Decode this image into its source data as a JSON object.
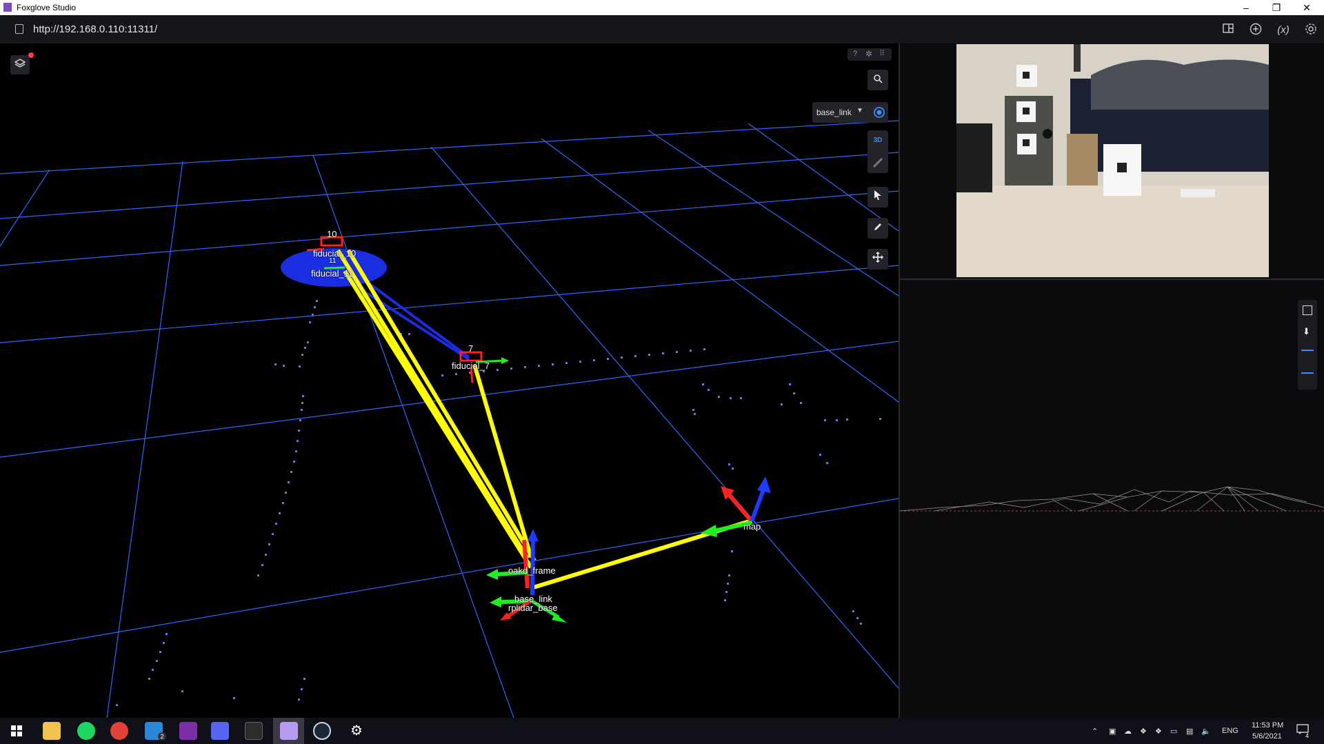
{
  "window": {
    "title": "Foxglove Studio",
    "minimize": "–",
    "restore": "❐",
    "close": "✕"
  },
  "url_bar": {
    "url": "http://192.168.0.110:11311/"
  },
  "top_icons": [
    "layout-icon",
    "add-panel-icon",
    "variables-icon",
    "settings-icon"
  ],
  "top_labels": {
    "variables": "(x)"
  },
  "panel_3d": {
    "follow_frame": "base_link",
    "mode_3d": "3D",
    "frame_labels": {
      "marker_10": "10",
      "fiducial_10": "fiducial_10",
      "marker_11": "11",
      "fiducial_11": "fiducial_11",
      "marker_7": "7",
      "fiducial_7": "fiducial_7",
      "map": "map",
      "oakd_frame": "oakd_frame",
      "base_link": "base_link",
      "rplidar_base": "rplidar_base"
    }
  },
  "taskbar": {
    "language": "ENG",
    "time": "11:53 PM",
    "date": "5/6/2021",
    "mail_badge": "2",
    "notification_count": "4"
  },
  "colors": {
    "grid": "#2f68ff",
    "accent": "#3b8cff",
    "axis_x": "#ff2020",
    "axis_y": "#20ee20",
    "axis_z": "#1d3cff",
    "link": "#ffff00",
    "scan": "#7b6fe0"
  }
}
